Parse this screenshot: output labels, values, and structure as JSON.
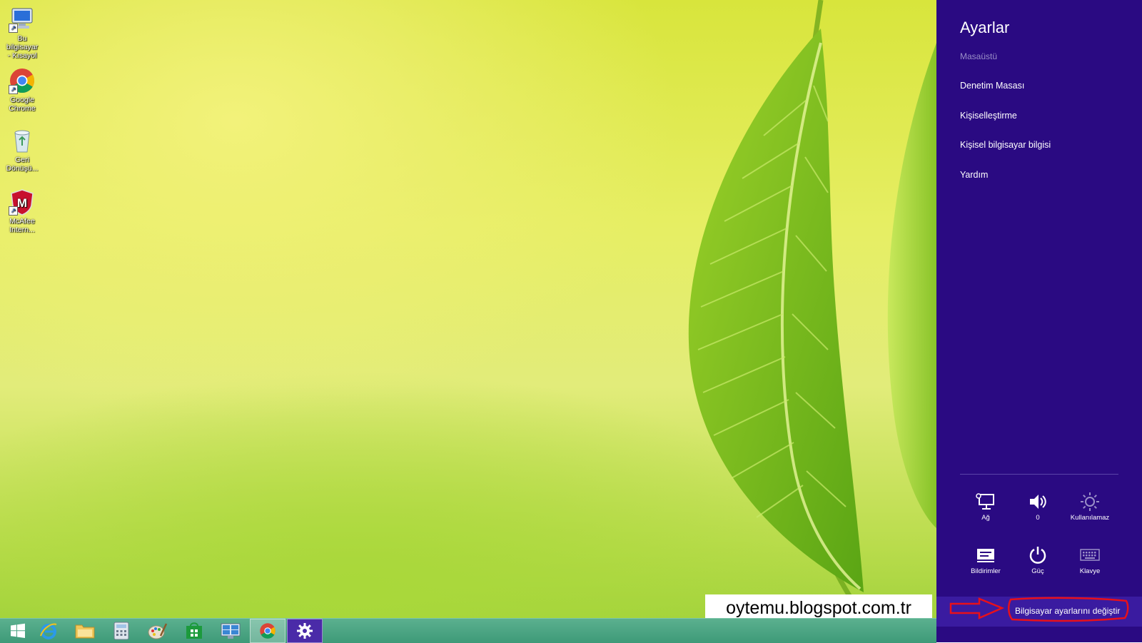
{
  "desktop": {
    "icons": [
      {
        "label": "Bu bilgisayar\n- Kısayol",
        "icon": "computer-icon"
      },
      {
        "label": "Google\nChrome",
        "icon": "chrome-icon"
      },
      {
        "label": "Geri\nDönüşü...",
        "icon": "recycle-bin-icon"
      },
      {
        "label": "McAfee\nIntern...",
        "icon": "mcafee-icon"
      }
    ]
  },
  "taskbar": {
    "items": [
      {
        "icon": "windows-start-icon"
      },
      {
        "icon": "internet-explorer-icon"
      },
      {
        "icon": "file-explorer-icon"
      },
      {
        "icon": "calculator-icon"
      },
      {
        "icon": "paint-icon"
      },
      {
        "icon": "store-icon"
      },
      {
        "icon": "remote-desktop-icon"
      },
      {
        "icon": "chrome-icon"
      },
      {
        "icon": "settings-gear-icon"
      }
    ]
  },
  "watermark": {
    "text": "oytemu.blogspot.com.tr"
  },
  "charms": {
    "title": "Ayarlar",
    "context": "Masaüstü",
    "menu": [
      "Denetim Masası",
      "Kişiselleştirme",
      "Kişisel bilgisayar bilgisi",
      "Yardım"
    ],
    "quick_settings": [
      {
        "label": "Ağ",
        "icon": "network-icon"
      },
      {
        "label": "0",
        "icon": "volume-icon"
      },
      {
        "label": "Kullanılamaz",
        "icon": "brightness-icon"
      },
      {
        "label": "Bildirimler",
        "icon": "notifications-icon"
      },
      {
        "label": "Güç",
        "icon": "power-icon"
      },
      {
        "label": "Klavye",
        "icon": "keyboard-icon"
      }
    ],
    "pc_settings_link": "Bilgisayar ayarlarını değiştir"
  },
  "colors": {
    "charms_bg": "#2a0a82",
    "taskbar": "#4aa384",
    "annotation": "#e8101a"
  }
}
